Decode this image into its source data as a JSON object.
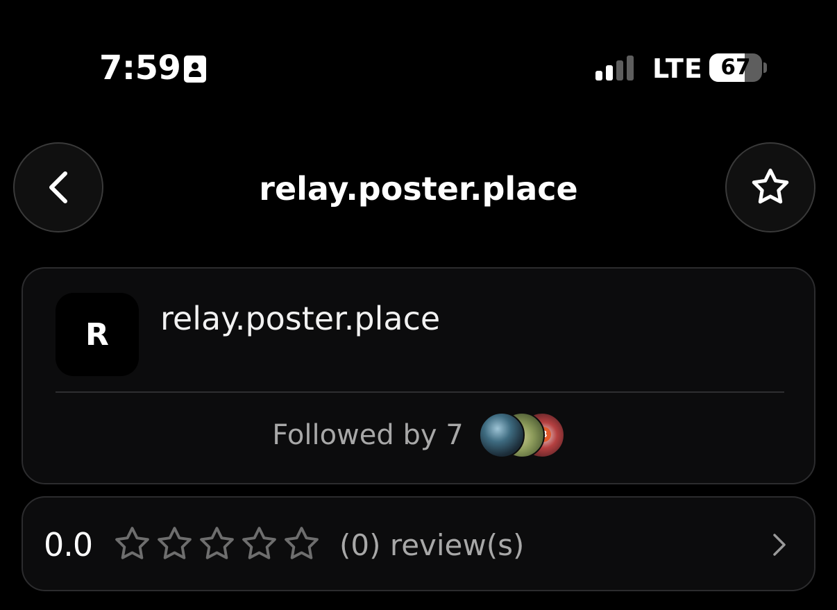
{
  "status_bar": {
    "time": "7:59",
    "network": "LTE",
    "battery_percent": "67",
    "battery_level": 0.67,
    "signal_bars_active": 2,
    "signal_bars_total": 4
  },
  "nav": {
    "title": "relay.poster.place",
    "back_icon": "chevron-left-icon",
    "favorite_icon": "star-outline-icon"
  },
  "relay_card": {
    "avatar_initial": "R",
    "name": "relay.poster.place",
    "followed_by_label": "Followed by 7",
    "follower_avatar_count": 3
  },
  "reviews": {
    "rating": "0.0",
    "stars_filled": 0,
    "stars_total": 5,
    "count_label": "(0) review(s)"
  },
  "colors": {
    "background": "#000000",
    "card": "#0c0c0d",
    "card_border": "#2c2c2e",
    "muted_text": "#a8a8a8"
  }
}
